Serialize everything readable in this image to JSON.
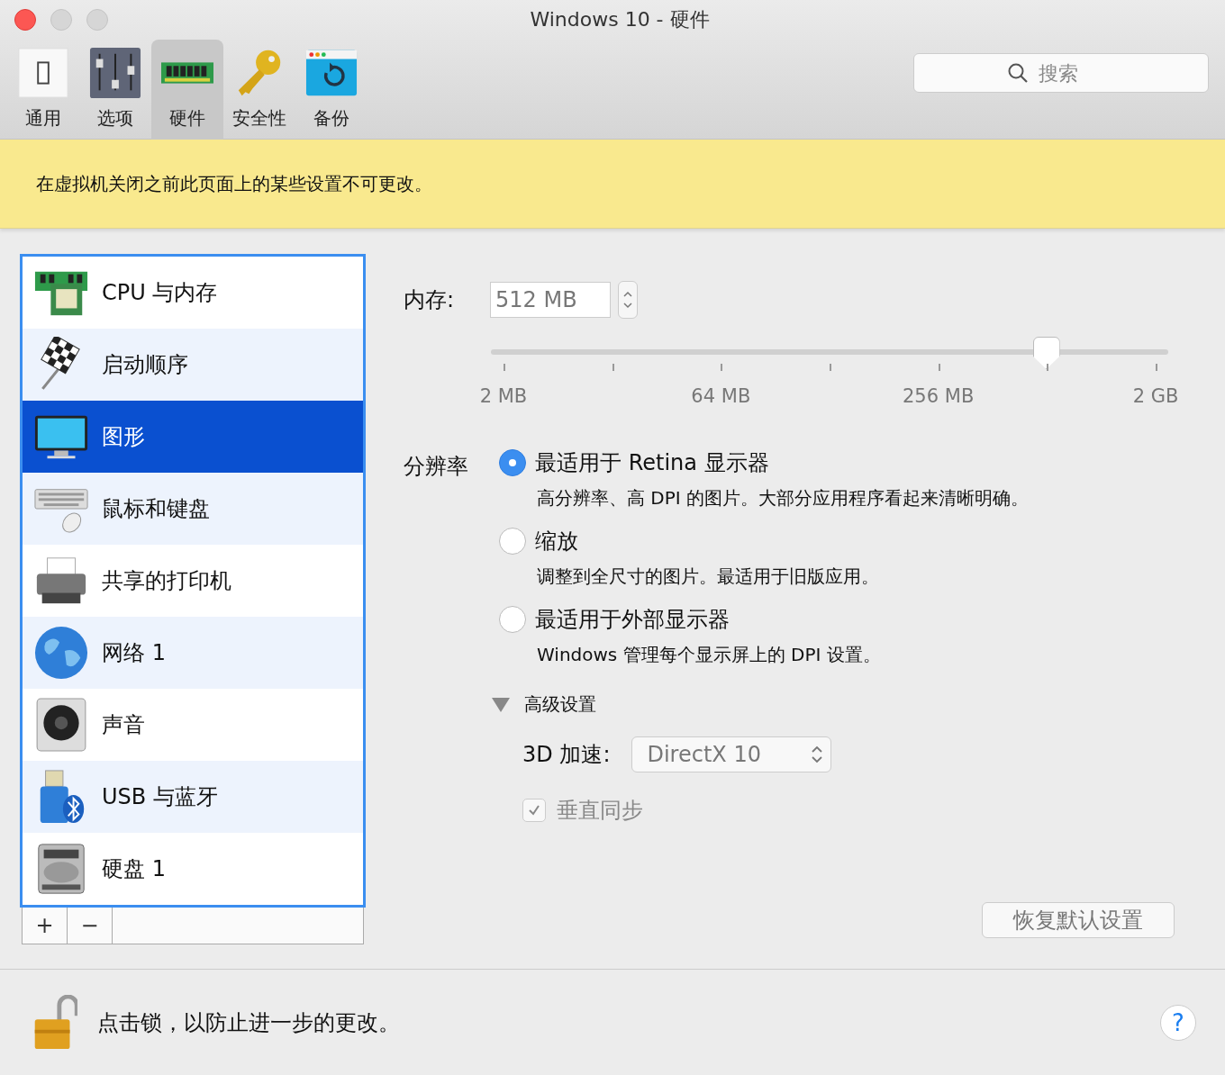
{
  "window": {
    "title": "Windows 10 - 硬件"
  },
  "toolbar": [
    {
      "label": "通用",
      "kind": "switch",
      "selected": false
    },
    {
      "label": "选项",
      "kind": "sliders",
      "selected": false
    },
    {
      "label": "硬件",
      "kind": "ram",
      "selected": true
    },
    {
      "label": "安全性",
      "kind": "key",
      "selected": false
    },
    {
      "label": "备份",
      "kind": "backup",
      "selected": false
    }
  ],
  "search": {
    "placeholder": "搜索"
  },
  "banner": "在虚拟机关闭之前此页面上的某些设置不可更改。",
  "sidebar": {
    "items": [
      {
        "label": "CPU 与内存",
        "kind": "cpu",
        "selected": false
      },
      {
        "label": "启动顺序",
        "kind": "flag",
        "selected": false
      },
      {
        "label": "图形",
        "kind": "monitor",
        "selected": true
      },
      {
        "label": "鼠标和键盘",
        "kind": "keyboard",
        "selected": false
      },
      {
        "label": "共享的打印机",
        "kind": "printer",
        "selected": false
      },
      {
        "label": "网络 1",
        "kind": "globe",
        "selected": false
      },
      {
        "label": "声音",
        "kind": "speaker",
        "selected": false
      },
      {
        "label": "USB 与蓝牙",
        "kind": "usb",
        "selected": false
      },
      {
        "label": "硬盘 1",
        "kind": "disk",
        "selected": false
      }
    ],
    "add": "+",
    "remove": "−"
  },
  "memory": {
    "label": "内存:",
    "value": "512 MB",
    "level": 0.82,
    "ticks": [
      "2 MB",
      "64 MB",
      "256 MB",
      "2 GB"
    ]
  },
  "resolution": {
    "label": "分辨率",
    "options": [
      {
        "label": "最适用于 Retina 显示器",
        "description": "高分辨率、高 DPI 的图片。大部分应用程序看起来清晰明确。",
        "selected": true
      },
      {
        "label": "缩放",
        "description": "调整到全尺寸的图片。最适用于旧版应用。",
        "selected": false
      },
      {
        "label": "最适用于外部显示器",
        "description": "Windows 管理每个显示屏上的 DPI 设置。",
        "selected": false
      }
    ]
  },
  "advanced": {
    "label": "高级设置",
    "expanded": true,
    "acceleration_label": "3D 加速:",
    "acceleration_value": "DirectX 10",
    "vsync": {
      "label": "垂直同步",
      "checked": true,
      "disabled": true
    }
  },
  "restore_button": "恢复默认设置",
  "footer": {
    "text": "点击锁，以防止进一步的更改。",
    "help": "?"
  }
}
